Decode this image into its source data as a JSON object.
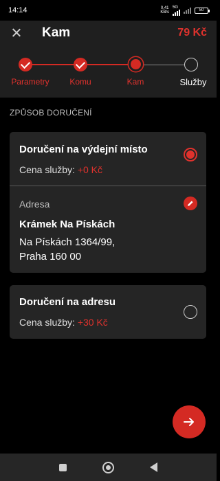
{
  "status_bar": {
    "time": "14:14",
    "net_speed_value": "0,41",
    "net_speed_unit": "KB/s",
    "network_type": "5G",
    "battery": "50"
  },
  "header": {
    "title": "Kam",
    "price": "79 Kč"
  },
  "stepper": {
    "steps": [
      {
        "label": "Parametry",
        "state": "done"
      },
      {
        "label": "Komu",
        "state": "done"
      },
      {
        "label": "Kam",
        "state": "current"
      },
      {
        "label": "Služby",
        "state": "todo"
      }
    ]
  },
  "section": {
    "heading": "ZPŮSOB DORUČENÍ"
  },
  "options": [
    {
      "title": "Doručení na výdejní místo",
      "price_label": "Cena služby: ",
      "price_value": "+0 Kč",
      "selected": true,
      "address": {
        "label": "Adresa",
        "name": "Krámek Na Pískách",
        "line1": "Na Pískách 1364/99,",
        "line2": "Praha 160 00"
      }
    },
    {
      "title": "Doručení na adresu",
      "price_label": "Cena služby: ",
      "price_value": "+30 Kč",
      "selected": false
    }
  ],
  "colors": {
    "accent": "#e0322d",
    "background": "#000000",
    "card": "#252525",
    "header": "#1f1f1f"
  },
  "icons": {
    "close": "close-icon",
    "edit": "pencil-icon",
    "next": "arrow-right-icon"
  }
}
